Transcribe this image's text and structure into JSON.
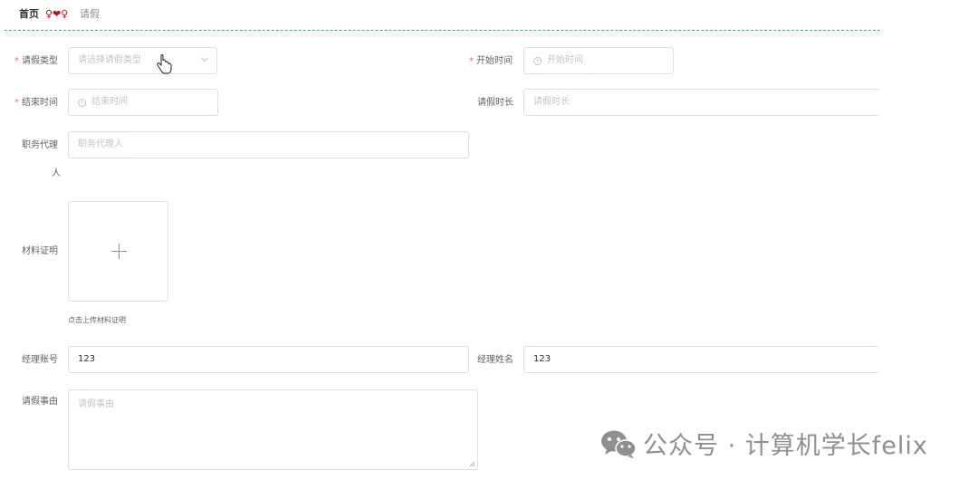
{
  "breadcrumb": {
    "home": "首页",
    "separator": "♀❤♀",
    "current": "请假"
  },
  "form": {
    "leave_type": {
      "label": "请假类型",
      "required": true,
      "placeholder": "请选择请假类型"
    },
    "start_time": {
      "label": "开始时间",
      "required": true,
      "placeholder": "开始时间"
    },
    "end_time": {
      "label": "结束时间",
      "required": true,
      "placeholder": "结束时间"
    },
    "duration": {
      "label": "请假时长",
      "placeholder": "请假时长"
    },
    "proxy": {
      "label_line1": "职务代理",
      "label_line2": "人",
      "placeholder": "职务代理人"
    },
    "material": {
      "label": "材料证明",
      "hint": "点击上传材料证明"
    },
    "manager_account": {
      "label": "经理账号",
      "value": "123"
    },
    "manager_name": {
      "label": "经理姓名",
      "value": "123"
    },
    "reason": {
      "label": "请假事由",
      "placeholder": "请假事由"
    }
  },
  "required_mark": "*",
  "watermark": {
    "text": "公众号 · 计算机学长felix"
  },
  "colors": {
    "required": "#f56c6c",
    "divider": "#3aa7d8",
    "separator": "#d9001b"
  }
}
